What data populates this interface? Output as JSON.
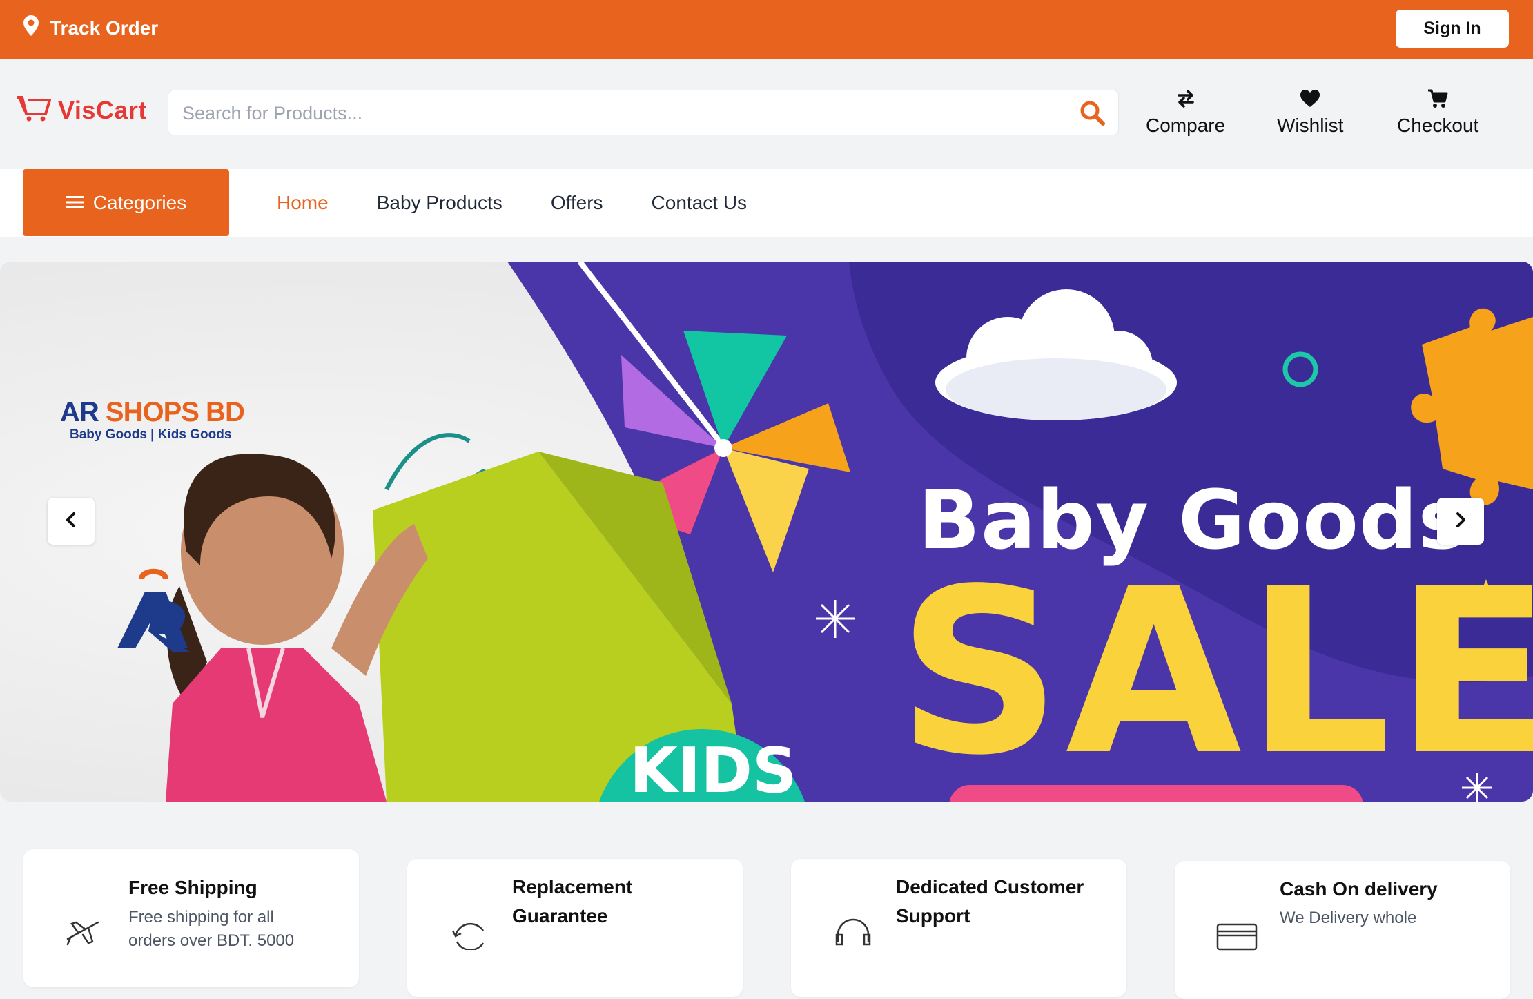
{
  "topbar": {
    "track_label": "Track Order",
    "signin_label": "Sign In"
  },
  "header": {
    "logo_text": "VisCart",
    "search_placeholder": "Search for Products...",
    "compare_label": "Compare",
    "wishlist_label": "Wishlist",
    "checkout_label": "Checkout"
  },
  "nav": {
    "categories_label": "Categories",
    "links": [
      "Home",
      "Baby Products",
      "Offers",
      "Contact Us"
    ],
    "active": "Home"
  },
  "banner": {
    "brand_name_1": "AR",
    "brand_name_2": "SHOPS BD",
    "brand_tagline": "Baby Goods | Kids Goods",
    "headline": "Baby Goods",
    "sale_text": "SALE",
    "kids_text": "KIDS"
  },
  "features": [
    {
      "title": "Free Shipping",
      "desc_lines": [
        "Free shipping for all",
        "orders over BDT. 5000"
      ]
    },
    {
      "title_lines": [
        "Replacement",
        "Guarantee"
      ]
    },
    {
      "title_lines": [
        "Dedicated Customer",
        "Support"
      ]
    },
    {
      "title": "Cash On delivery",
      "desc_lines": [
        "We Delivery whole"
      ]
    }
  ],
  "colors": {
    "brand_orange": "#e8631e",
    "banner_purple": "#4a36a8",
    "sale_yellow": "#f9d23c",
    "logo_red": "#e53935"
  }
}
